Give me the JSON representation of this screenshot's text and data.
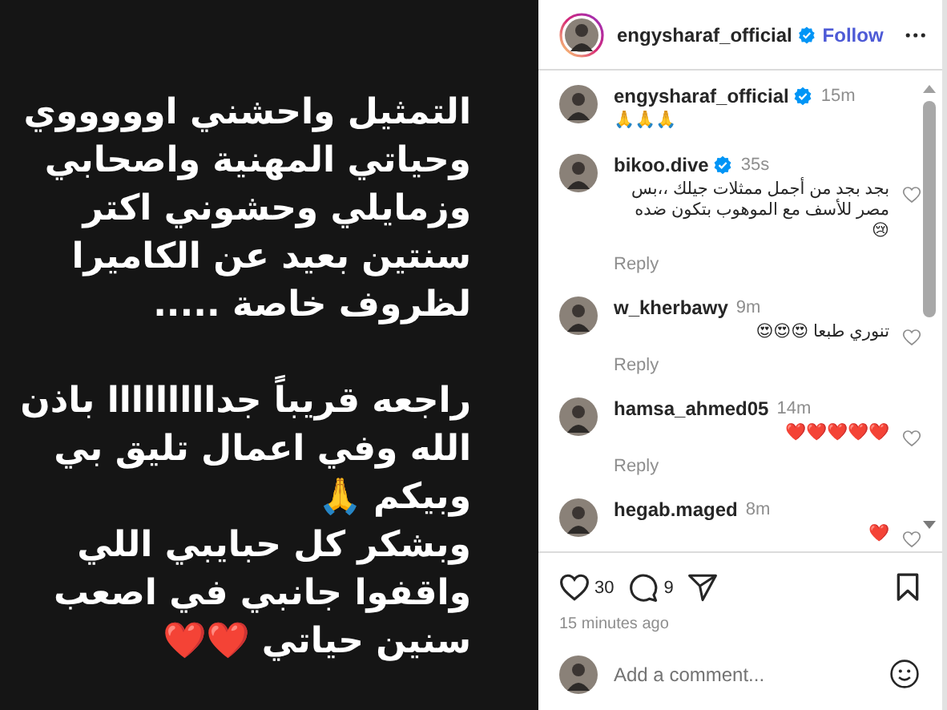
{
  "post_image": {
    "paragraphs": [
      [
        "التمثيل واحشني اوووووي",
        "وحياتي المهنية واصحابي",
        "وزمايلي وحشوني اكتر",
        "سنتين بعيد عن الكاميرا",
        "لظروف خاصة ....."
      ],
      [
        "راجعه قريباً جدااااااااا باذن",
        "الله وفي اعمال تليق بي",
        "وبيكم 🙏",
        "وبشكر كل حبايبي اللي",
        "واقفوا جانبي في اصعب",
        "سنين حياتي ❤️❤️"
      ]
    ]
  },
  "header": {
    "username": "engysharaf_official",
    "verified": true,
    "follow": "Follow"
  },
  "comments": [
    {
      "username": "engysharaf_official",
      "verified": true,
      "time": "15m",
      "text": "🙏🙏🙏",
      "kind": "caption"
    },
    {
      "username": "bikoo.dive",
      "verified": true,
      "time": "35s",
      "text": "بجد بجد من أجمل ممثلات جيلك ،،بس مصر للأسف مع الموهوب بتكون ضده 😢",
      "kind": "comment",
      "reply": "Reply"
    },
    {
      "username": "w_kherbawy",
      "verified": false,
      "time": "9m",
      "text": "تنوري طبعا 😍😍😍",
      "kind": "comment",
      "reply": "Reply"
    },
    {
      "username": "hamsa_ahmed05",
      "verified": false,
      "time": "14m",
      "text": "❤️❤️❤️❤️❤️",
      "kind": "comment",
      "reply": "Reply"
    },
    {
      "username": "hegab.maged",
      "verified": false,
      "time": "8m",
      "text": "❤️",
      "kind": "comment"
    }
  ],
  "actions": {
    "likes": "30",
    "comments": "9",
    "time": "15 minutes ago"
  },
  "add_comment": {
    "placeholder": "Add a comment..."
  }
}
